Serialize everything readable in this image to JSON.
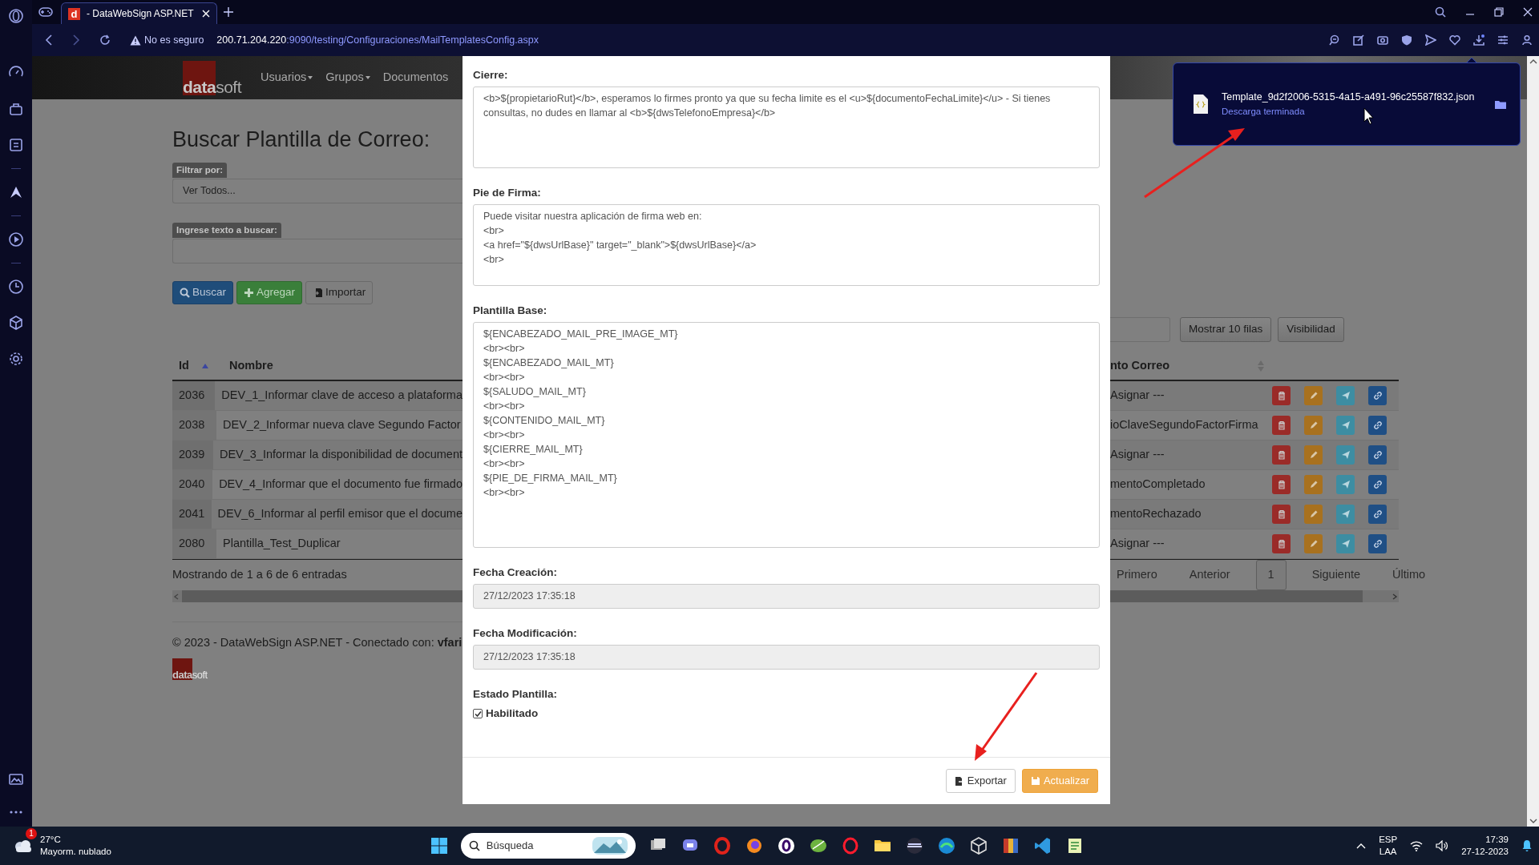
{
  "browser": {
    "tabs": [
      {
        "favicon": "d",
        "title": "- DataWebSign ASP.NET",
        "selected": true
      }
    ],
    "security": "No es seguro",
    "url": {
      "host": "200.71.204.220",
      "path": ":9090/testing/Configuraciones/MailTemplatesConfig.aspx"
    }
  },
  "download": {
    "file": "Template_9d2f2006-5315-4a15-a491-96c25587f832.json",
    "status": "Descarga terminada"
  },
  "navbar": {
    "logo": {
      "part1": "data",
      "part2": "soft"
    },
    "menu": [
      {
        "label": "Usuarios",
        "caret": true
      },
      {
        "label": "Grupos",
        "caret": true
      },
      {
        "label": "Documentos",
        "caret": false
      }
    ]
  },
  "page": {
    "title": "Buscar Plantilla de Correo:",
    "filter_label": "Filtrar por:",
    "filter_value": "Ver Todos...",
    "search_label": "Ingrese texto a buscar:",
    "buttons": [
      {
        "label": "Buscar",
        "kind": "primary"
      },
      {
        "label": "Agregar",
        "kind": "success"
      },
      {
        "label": "Importar",
        "kind": "default"
      }
    ],
    "table_tools": [
      "Mostrar 10 filas",
      "Visibilidad"
    ],
    "table": {
      "columns": [
        {
          "label": "Id",
          "sorted": true
        },
        {
          "label": "Nombre",
          "sorted": false,
          "sortable": false
        },
        {
          "label": "nto Correo",
          "sorted": false,
          "sortable": true
        }
      ],
      "rows": [
        {
          "id": "2036",
          "name": "DEV_1_Informar clave de acceso a plataforma",
          "template": "Asignar ---"
        },
        {
          "id": "2038",
          "name": "DEV_2_Informar nueva clave Segundo Factor",
          "template": "ioClaveSegundoFactorFirma"
        },
        {
          "id": "2039",
          "name": "DEV_3_Informar la disponibilidad de document",
          "template": "Asignar ---"
        },
        {
          "id": "2040",
          "name": "DEV_4_Informar que el documento fue firmado",
          "template": "mentoCompletado"
        },
        {
          "id": "2041",
          "name": "DEV_6_Informar al perfil emisor que el docume",
          "template": "mentoRechazado"
        },
        {
          "id": "2080",
          "name": "Plantilla_Test_Duplicar",
          "template": "Asignar ---"
        }
      ]
    },
    "info": "Mostrando de 1 a 6 de 6 entradas",
    "pagination": [
      {
        "label": "Primero",
        "selected": false
      },
      {
        "label": "Anterior",
        "selected": false
      },
      {
        "label": "1",
        "selected": true
      },
      {
        "label": "Siguiente",
        "selected": false
      },
      {
        "label": "Último",
        "selected": false
      }
    ],
    "footer": "© 2023 - DataWebSign ASP.NET - Conectado con: **vfari**",
    "footer_logo": {
      "part1": "data",
      "part2": "soft"
    }
  },
  "modal": {
    "fields": [
      {
        "kind": "textarea",
        "label": "Cierre:",
        "value": "<b>${propietarioRut}</b>, esperamos lo firmes pronto ya que su fecha limite es el <u>${documentoFechaLimite}</u> - Si tienes consultas, no dudes en llamar al <b>${dwsTelefonoEmpresa}</b>"
      },
      {
        "kind": "textarea",
        "label": "Pie de Firma:",
        "value": "Puede visitar nuestra aplicación de firma web en:\n<br>\n<a href=\"${dwsUrlBase}\" target=\"_blank\">${dwsUrlBase}</a>\n<br>"
      },
      {
        "kind": "bigtextarea",
        "label": "Plantilla Base:",
        "value": "${ENCABEZADO_MAIL_PRE_IMAGE_MT}\n<br><br>\n${ENCABEZADO_MAIL_MT}\n<br><br>\n${SALUDO_MAIL_MT}\n<br><br>\n${CONTENIDO_MAIL_MT}\n<br><br>\n${CIERRE_MAIL_MT}\n<br><br>\n${PIE_DE_FIRMA_MAIL_MT}\n<br><br>"
      },
      {
        "kind": "readonly",
        "label": "Fecha Creación:",
        "value": "27/12/2023 17:35:18"
      },
      {
        "kind": "readonly",
        "label": "Fecha Modificación:",
        "value": "27/12/2023 17:35:18"
      },
      {
        "kind": "checkbox",
        "label": "Estado Plantilla:",
        "option": "Habilitado",
        "checked": true
      }
    ],
    "buttons": [
      {
        "label": "Exportar",
        "kind": "default"
      },
      {
        "label": "Actualizar",
        "kind": "warning"
      }
    ]
  },
  "taskbar": {
    "temperature": "27°C",
    "weather": "Mayorm. nublado",
    "badge": "1",
    "search_placeholder": "Búsqueda",
    "language": "ESP",
    "layout": "LAA",
    "time": "17:39",
    "date": "27-12-2023"
  }
}
